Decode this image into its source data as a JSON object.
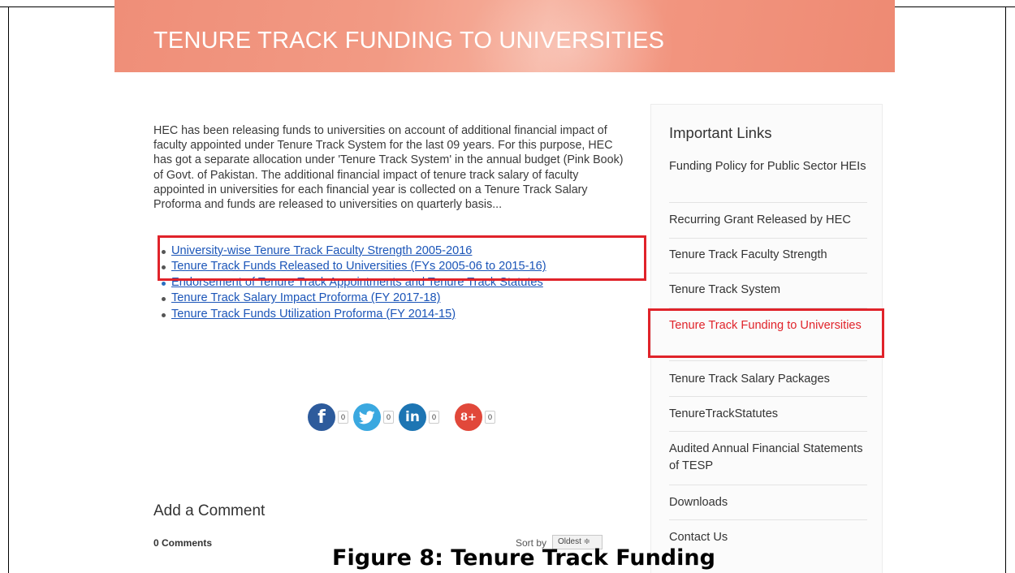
{
  "banner": {
    "title": "TENURE TRACK FUNDING TO UNIVERSITIES"
  },
  "intro": "HEC has been releasing funds to universities on account of additional financial impact of faculty appointed under Tenure Track System for the last 09 years. For this purpose, HEC has got a separate allocation under 'Tenure Track System' in the annual budget (Pink Book) of Govt. of Pakistan. The additional financial impact of tenure track salary of faculty appointed in universities for each financial year is collected on a Tenure Track Salary Proforma and funds are released to universities on quarterly basis...",
  "documents": [
    "University-wise Tenure Track Faculty Strength 2005-2016",
    "Tenure Track Funds Released to Universities (FYs 2005-06 to 2015-16)",
    "Endorsement of Tenure Track Appointments and Tenure Track Statutes",
    "Tenure Track Salary Impact Proforma (FY 2017-18)",
    "Tenure Track Funds Utilization Proforma (FY 2014-15)"
  ],
  "share": {
    "facebook": {
      "icon": "facebook-icon",
      "glyph": "f",
      "count": "0",
      "color": "#2d5b9c"
    },
    "twitter": {
      "icon": "twitter-icon",
      "count": "0",
      "color": "#3aa8e0"
    },
    "linkedin": {
      "icon": "linkedin-icon",
      "glyph": "in",
      "count": "0",
      "color": "#1d75b3"
    },
    "googleplus": {
      "icon": "google-plus-icon",
      "glyph": "8+",
      "count": "0",
      "color": "#e1483a"
    }
  },
  "comments": {
    "heading": "Add a Comment",
    "count": "0 Comments",
    "sort_label": "Sort by",
    "sort_value": "Oldest ≑"
  },
  "sidebar": {
    "title": "Important Links",
    "items": [
      "Funding Policy for Public Sector HEIs",
      "Recurring Grant Released by HEC",
      "Tenure Track Faculty Strength",
      "Tenure Track System",
      "Tenure Track Funding to Universities",
      "Tenure Track Salary Packages",
      "TenureTrackStatutes",
      "Audited Annual Financial Statements of TESP",
      "Downloads",
      "Contact Us"
    ],
    "active_index": 4
  },
  "caption": "Figure 8: Tenure Track Funding",
  "colors": {
    "banner": "#f29a84",
    "highlight": "#e0232a",
    "link": "#1b55b8"
  }
}
